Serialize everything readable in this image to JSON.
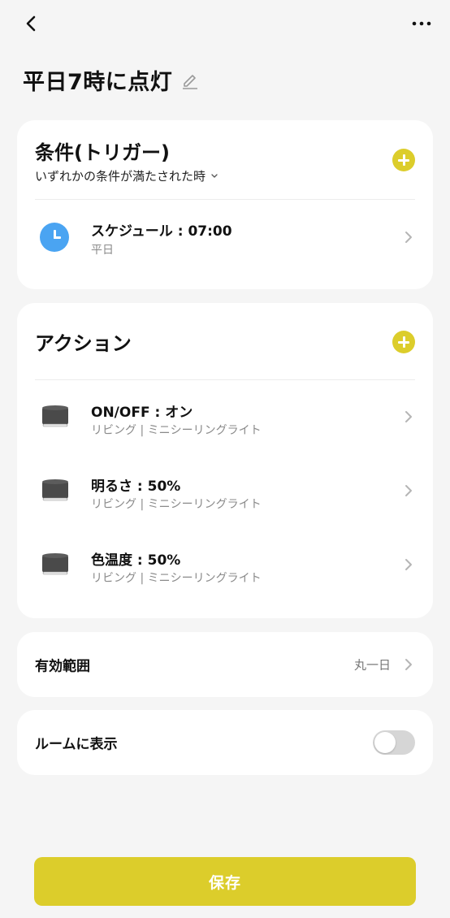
{
  "header": {
    "title": "平日7時に点灯"
  },
  "trigger": {
    "title": "条件(トリガー)",
    "condition_mode": "いずれかの条件が満たされた時",
    "items": [
      {
        "title": "スケジュール : 07:00",
        "subtitle": "平日"
      }
    ]
  },
  "actions": {
    "title": "アクション",
    "items": [
      {
        "title": "ON/OFF : オン",
        "subtitle": "リビング | ミニシーリングライト"
      },
      {
        "title": "明るさ : 50%",
        "subtitle": "リビング | ミニシーリングライト"
      },
      {
        "title": "色温度 : 50%",
        "subtitle": "リビング | ミニシーリングライト"
      }
    ]
  },
  "range": {
    "label": "有効範囲",
    "value": "丸一日"
  },
  "room": {
    "label": "ルームに表示",
    "enabled": false
  },
  "save_label": "保存",
  "colors": {
    "accent": "#dccd2b",
    "clock_icon": "#4aa4f2",
    "background": "#f5f5f5",
    "card": "#ffffff"
  }
}
